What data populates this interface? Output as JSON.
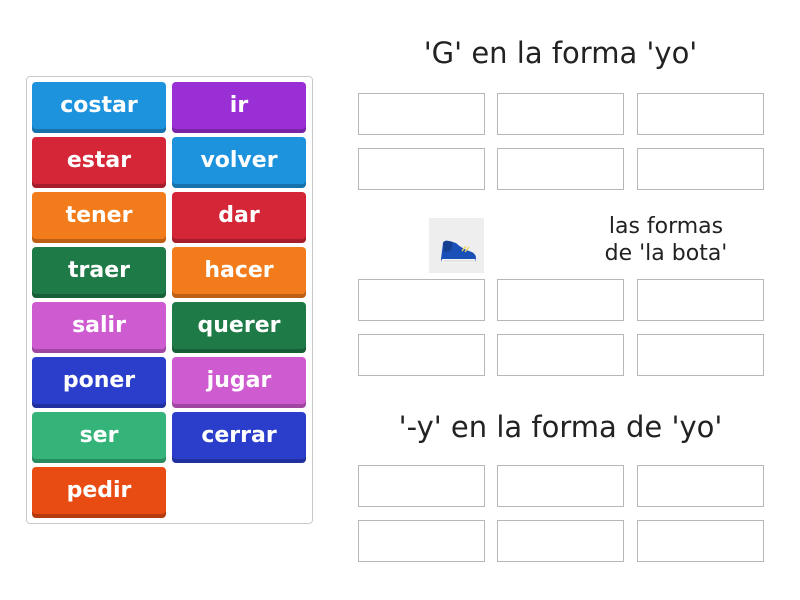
{
  "tiles": [
    {
      "label": "costar",
      "color": "#1e93dd"
    },
    {
      "label": "ir",
      "color": "#9b2fd6"
    },
    {
      "label": "estar",
      "color": "#d42637"
    },
    {
      "label": "volver",
      "color": "#1e93dd"
    },
    {
      "label": "tener",
      "color": "#f27c1c"
    },
    {
      "label": "dar",
      "color": "#d42637"
    },
    {
      "label": "traer",
      "color": "#1e7a46"
    },
    {
      "label": "hacer",
      "color": "#f27c1c"
    },
    {
      "label": "salir",
      "color": "#cf5bd0"
    },
    {
      "label": "querer",
      "color": "#1e7a46"
    },
    {
      "label": "poner",
      "color": "#2a3ecb"
    },
    {
      "label": "jugar",
      "color": "#cf5bd0"
    },
    {
      "label": "ser",
      "color": "#35b47a"
    },
    {
      "label": "cerrar",
      "color": "#2a3ecb"
    },
    {
      "label": "pedir",
      "color": "#e84c12"
    }
  ],
  "groups": [
    {
      "title": "'G' en la forma 'yo'"
    },
    {
      "title_line1": "las formas",
      "title_line2": "de 'la bota'",
      "image": "boot-sneaker-image"
    },
    {
      "title": "'-y' en la forma de 'yo'"
    }
  ]
}
